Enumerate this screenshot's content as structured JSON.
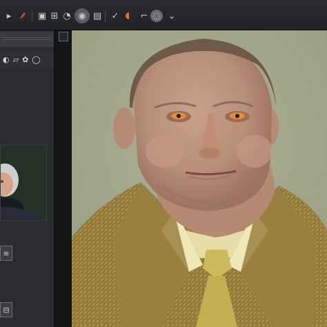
{
  "app": {
    "toolbar": {
      "icons": [
        "select-icon",
        "brush-icon",
        "layer-icon",
        "transform-icon",
        "camera-icon",
        "sphere-icon",
        "frame-icon",
        "pen-icon",
        "mask-icon",
        "adjust-icon",
        "export-icon"
      ]
    },
    "left_panel": {
      "mini_toolbar_icons": [
        "zoom-icon",
        "folder-icon",
        "settings-icon",
        "refresh-icon"
      ],
      "thumbnail": "portrait-thumbnail"
    },
    "viewport": {
      "content": "3d-character-render"
    },
    "colors": {
      "background": "#1c1d20",
      "panel": "#2b2c30",
      "viewport_bg": "#a6a98d",
      "suit": "#a3884a",
      "tie": "#c8b560",
      "skin": "#b8907a"
    }
  }
}
